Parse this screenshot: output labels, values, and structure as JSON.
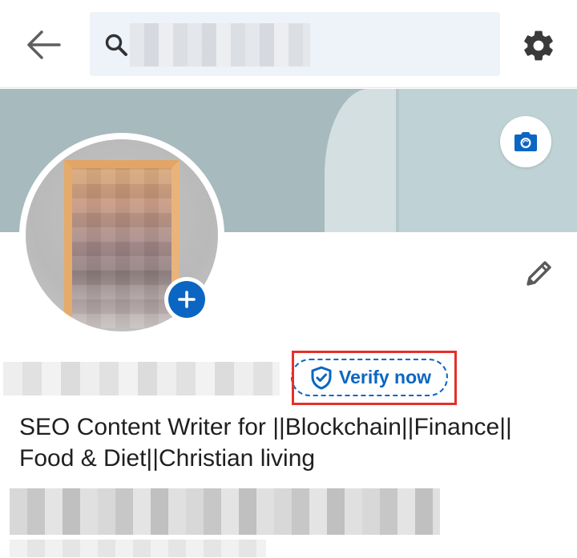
{
  "header": {
    "back_icon": "arrow-left-icon",
    "search": {
      "value": "",
      "placeholder": "",
      "icon": "search-icon"
    },
    "settings_icon": "gear-icon"
  },
  "cover": {
    "camera_icon": "camera-icon",
    "colors": {
      "cover_main": "#a7babe",
      "cover_light": "#d3dfe1",
      "cover_right": "#bfd2d5"
    }
  },
  "profile": {
    "add_photo_icon": "plus-icon",
    "edit_icon": "pencil-icon",
    "verify": {
      "label": "Verify now",
      "icon": "shield-check-icon"
    },
    "headline": "SEO Content Writer for ||Blockchain||Finance|| Food & Diet||Christian living"
  },
  "colors": {
    "accent": "#0a66c2",
    "highlight": "#e4302b"
  }
}
